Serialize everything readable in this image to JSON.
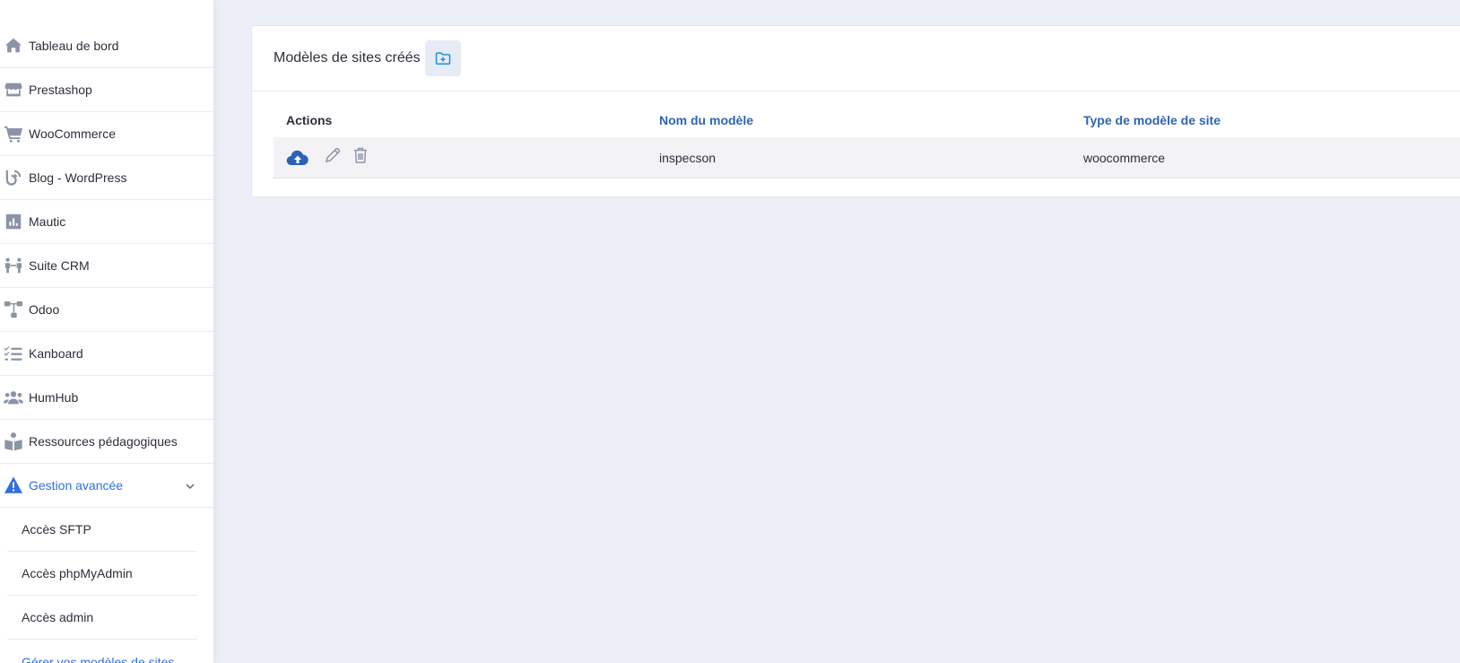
{
  "sidebar": {
    "items": [
      {
        "label": "Tableau de bord",
        "icon": "home-icon"
      },
      {
        "label": "Prestashop",
        "icon": "store-icon"
      },
      {
        "label": "WooCommerce",
        "icon": "cart-icon"
      },
      {
        "label": "Blog - WordPress",
        "icon": "blog-icon"
      },
      {
        "label": "Mautic",
        "icon": "chart-icon"
      },
      {
        "label": "Suite CRM",
        "icon": "handshake-icon"
      },
      {
        "label": "Odoo",
        "icon": "sitemap-icon"
      },
      {
        "label": "Kanboard",
        "icon": "tasks-icon"
      },
      {
        "label": "HumHub",
        "icon": "users-icon"
      },
      {
        "label": "Ressources pédagogiques",
        "icon": "book-reader-icon"
      },
      {
        "label": "Gestion avancée",
        "icon": "warning-icon"
      }
    ],
    "sub_items": [
      {
        "label": "Accès SFTP"
      },
      {
        "label": "Accès phpMyAdmin"
      },
      {
        "label": "Accès admin"
      },
      {
        "label": "Gérer vos modèles de sites"
      }
    ]
  },
  "panel": {
    "title": "Modèles de sites créés",
    "add_icon": "folder-plus-icon"
  },
  "table": {
    "headers": {
      "actions": "Actions",
      "name": "Nom du modèle",
      "type": "Type de modèle de site"
    },
    "rows": [
      {
        "name": "inspecson",
        "type": "woocommerce"
      }
    ]
  },
  "colors": {
    "accent": "#2f6fde",
    "header_link": "#2f64b4",
    "icon_gray": "#8a94a6",
    "upload_blue": "#2a62b5",
    "background": "#eceff7"
  }
}
